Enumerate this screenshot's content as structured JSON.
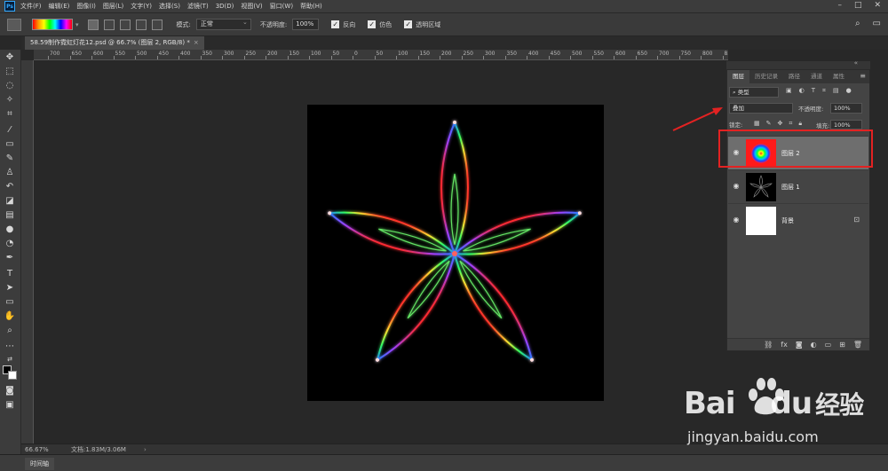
{
  "app": {
    "logo": "Ps"
  },
  "menu": [
    "文件(F)",
    "编辑(E)",
    "图像(I)",
    "图层(L)",
    "文字(Y)",
    "选择(S)",
    "滤镜(T)",
    "3D(D)",
    "视图(V)",
    "窗口(W)",
    "帮助(H)"
  ],
  "options": {
    "mode_label": "模式:",
    "mode_value": "正常",
    "opacity_label": "不透明度:",
    "opacity_value": "100%",
    "reverse_label": "反向",
    "dither_label": "仿色",
    "transparency_label": "透明区域"
  },
  "document": {
    "tab_title": "58.59制作霓虹灯花12.psd @ 66.7% (图层 2, RGB/8) *"
  },
  "ruler": [
    "700",
    "650",
    "600",
    "550",
    "500",
    "450",
    "400",
    "350",
    "300",
    "250",
    "200",
    "150",
    "100",
    "50",
    "0",
    "50",
    "100",
    "150",
    "200",
    "250",
    "300",
    "350",
    "400",
    "450",
    "500",
    "550",
    "600",
    "650",
    "700",
    "750",
    "800",
    "850",
    "900",
    "950"
  ],
  "status": {
    "zoom": "66.67%",
    "doc_info": "文档:1.83M/3.06M"
  },
  "timeline": {
    "label": "时间轴"
  },
  "layers_panel": {
    "tabs": [
      "图层",
      "历史记录",
      "路径",
      "通道",
      "属性"
    ],
    "filter_label": "类型",
    "blend_mode": "叠加",
    "opacity_label": "不透明度:",
    "opacity_value": "100%",
    "lock_label": "锁定:",
    "fill_label": "填充:",
    "fill_value": "100%",
    "layers": [
      {
        "name": "图层 2",
        "selected": true
      },
      {
        "name": "图层 1",
        "selected": false
      },
      {
        "name": "背景",
        "selected": false
      }
    ]
  },
  "watermark": {
    "brand": "Bai",
    "brand2": "du",
    "brand3": "经验",
    "url": "jingyan.baidu.com"
  },
  "colors": {
    "annotation": "#e32222"
  }
}
